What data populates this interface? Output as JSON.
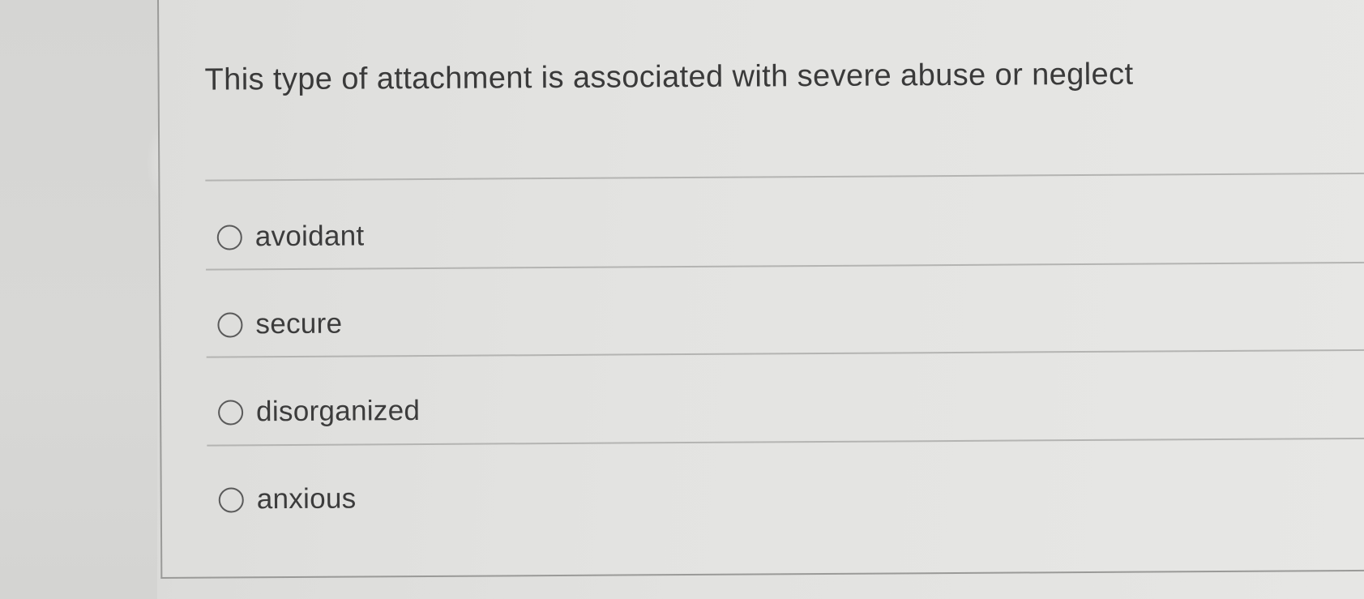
{
  "question": {
    "text": "This type of attachment is associated with severe abuse or neglect"
  },
  "options": [
    {
      "label": "avoidant"
    },
    {
      "label": "secure"
    },
    {
      "label": "disorganized"
    },
    {
      "label": "anxious"
    }
  ],
  "colors": {
    "background": "#e2e2e0",
    "text": "#3a3a3a",
    "divider": "#b4b4b2",
    "card_border": "#9a9a98",
    "radio_border": "#5a5a5a"
  },
  "icons": {
    "radio": "radio-unchecked-icon"
  }
}
